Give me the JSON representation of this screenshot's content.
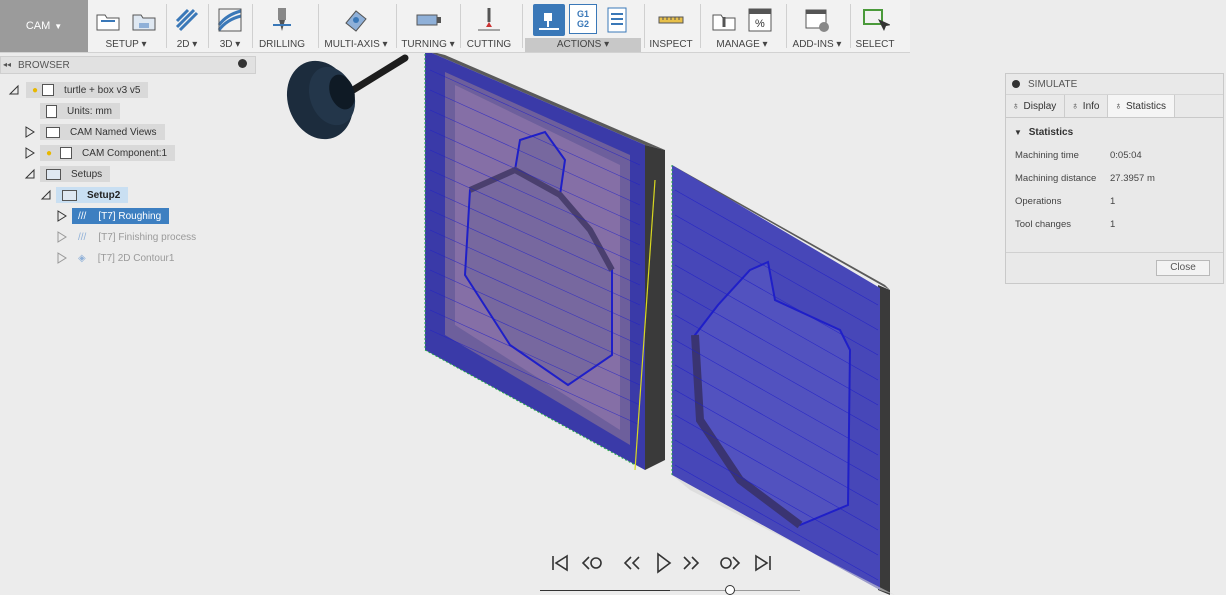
{
  "workspace": {
    "label": "CAM"
  },
  "toolbar": {
    "groups": [
      {
        "label": "SETUP ▾"
      },
      {
        "label": "2D ▾"
      },
      {
        "label": "3D ▾"
      },
      {
        "label": "DRILLING"
      },
      {
        "label": "MULTI-AXIS ▾"
      },
      {
        "label": "TURNING ▾"
      },
      {
        "label": "CUTTING"
      },
      {
        "label": "ACTIONS ▾"
      },
      {
        "label": "INSPECT"
      },
      {
        "label": "MANAGE ▾"
      },
      {
        "label": "ADD-INS ▾"
      },
      {
        "label": "SELECT"
      }
    ],
    "g1g2": {
      "l1": "G1",
      "l2": "G2"
    }
  },
  "browser": {
    "title": "BROWSER",
    "items": [
      {
        "label": "turtle + box v3 v5"
      },
      {
        "label": "Units: mm"
      },
      {
        "label": "CAM Named Views"
      },
      {
        "label": "CAM Component:1"
      },
      {
        "label": "Setups"
      },
      {
        "label": "Setup2"
      },
      {
        "label": "[T7] Roughing"
      },
      {
        "label": "[T7] Finishing process"
      },
      {
        "label": "[T7] 2D Contour1"
      }
    ]
  },
  "simulate": {
    "title": "SIMULATE",
    "tabs": [
      {
        "label": "Display"
      },
      {
        "label": "Info"
      },
      {
        "label": "Statistics"
      }
    ],
    "section": "Statistics",
    "stats": [
      {
        "label": "Machining time",
        "value": "0:05:04"
      },
      {
        "label": "Machining distance",
        "value": "27.3957 m"
      },
      {
        "label": "Operations",
        "value": "1"
      },
      {
        "label": "Tool changes",
        "value": "1"
      }
    ],
    "close_label": "Close"
  },
  "playback": {
    "progress": 0.5
  },
  "colors": {
    "accent": "#3d7fc1",
    "toolpath": "#1f1fc8",
    "stock": "#8a72a8"
  }
}
